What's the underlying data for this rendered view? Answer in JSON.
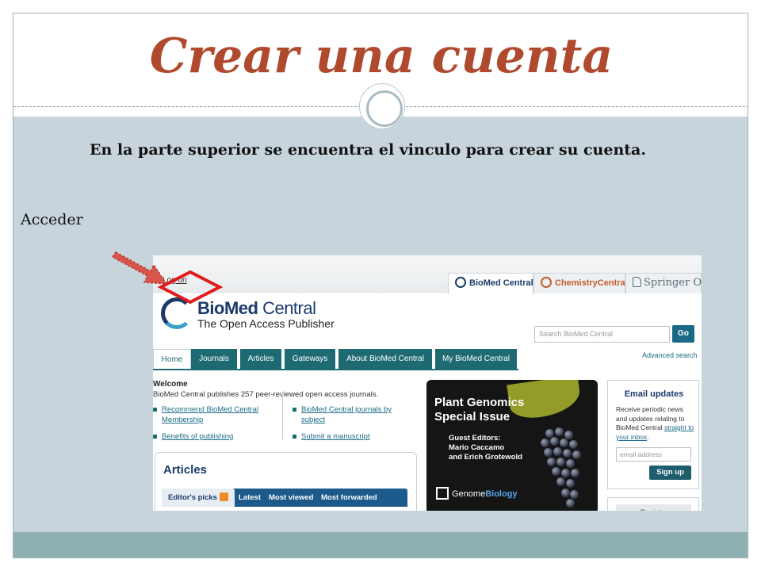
{
  "slide": {
    "title": "Crear una cuenta",
    "instruction": "En la parte superior se encuentra el vinculo para crear su cuenta.",
    "label": "Acceder",
    "colors": {
      "title": "#b04a2e",
      "band": "#c7d4dc",
      "footer": "#8fb0b2",
      "highlight": "#e01b1b",
      "arrow": "#d9544a"
    }
  },
  "screenshot": {
    "logon": "Log on",
    "portal_tabs": [
      {
        "label": "BioMed Central",
        "icon": "biomed-central-logo-icon"
      },
      {
        "label": "ChemistryCentral",
        "icon": "chemistry-central-logo-icon"
      },
      {
        "label": "Springer Open",
        "icon": "springer-open-logo-icon"
      }
    ],
    "logo": {
      "name_bold": "BioMed",
      "name_light": " Central",
      "tagline": "The Open Access Publisher"
    },
    "search": {
      "placeholder": "Search BioMed Central",
      "button": "Go",
      "advanced": "Advanced search"
    },
    "nav": [
      "Home",
      "Journals",
      "Articles",
      "Gateways",
      "About BioMed Central",
      "My BioMed Central"
    ],
    "welcome": {
      "title": "Welcome",
      "description": "BioMed Central publishes 257 peer-reviewed open access journals.",
      "links": {
        "recommend": "Recommend BioMed Central Membership",
        "benefits": "Benefits of publishing",
        "by_subject": "BioMed Central journals by subject",
        "submit": "Submit a manuscript"
      }
    },
    "articles": {
      "title": "Articles",
      "tabs": [
        "Editor's picks",
        "Latest",
        "Most viewed",
        "Most forwarded"
      ]
    },
    "banner": {
      "title": "Plant Genomics Special Issue",
      "guest_editors": "Guest Editors:",
      "editor_1": "Mario Caccamo",
      "editor_2": "and Erich Grotewold",
      "journal_plain": "Genome",
      "journal_accent": "Biology"
    },
    "email_updates": {
      "title": "Email updates",
      "text": "Receive periodic news and updates relating to BioMed Central ",
      "link": "straight to your inbox",
      "text_end": ".",
      "placeholder": "email address",
      "button": "Sign up"
    },
    "register": "Register"
  }
}
